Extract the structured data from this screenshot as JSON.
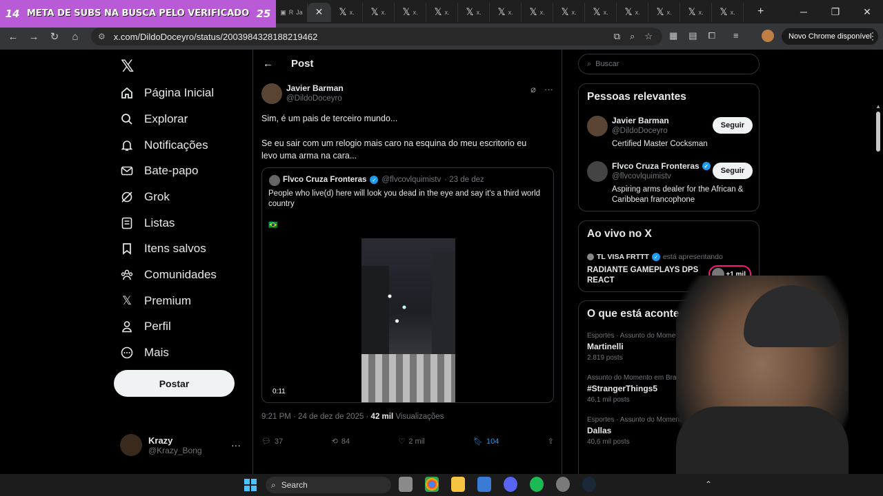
{
  "stream_overlay": {
    "left_count": "14",
    "goal_text": "META DE SUBS NA BUSCA PELO VERIFICADO",
    "right_count": "25"
  },
  "browser": {
    "tabs": [
      {
        "icon": "twitch-icon",
        "label": "R"
      },
      {
        "icon": "twitch-icon",
        "label": "Ja"
      },
      {
        "icon": "x-logo",
        "label": "x.",
        "active": true
      },
      {
        "icon": "x-logo",
        "label": "x."
      },
      {
        "icon": "x-logo",
        "label": "x."
      },
      {
        "icon": "x-logo",
        "label": "x."
      },
      {
        "icon": "x-logo",
        "label": "x."
      },
      {
        "icon": "x-logo",
        "label": "x."
      },
      {
        "icon": "x-logo",
        "label": "x."
      },
      {
        "icon": "x-logo",
        "label": "x."
      },
      {
        "icon": "x-logo",
        "label": "x."
      },
      {
        "icon": "x-logo",
        "label": "x."
      },
      {
        "icon": "x-logo",
        "label": "x."
      },
      {
        "icon": "x-logo",
        "label": "x."
      },
      {
        "icon": "x-logo",
        "label": "x."
      },
      {
        "icon": "x-logo",
        "label": "x."
      }
    ],
    "url": "x.com/DildoDoceyro/status/2003984328188219462",
    "update_button": "Novo Chrome disponível"
  },
  "nav": {
    "items": [
      {
        "icon": "home-icon",
        "label": "Página Inicial"
      },
      {
        "icon": "search-icon",
        "label": "Explorar"
      },
      {
        "icon": "bell-icon",
        "label": "Notificações"
      },
      {
        "icon": "mail-icon",
        "label": "Bate-papo"
      },
      {
        "icon": "grok-icon",
        "label": "Grok"
      },
      {
        "icon": "list-icon",
        "label": "Listas"
      },
      {
        "icon": "bookmark-icon",
        "label": "Itens salvos"
      },
      {
        "icon": "communities-icon",
        "label": "Comunidades"
      },
      {
        "icon": "x-logo",
        "label": "Premium"
      },
      {
        "icon": "person-icon",
        "label": "Perfil"
      },
      {
        "icon": "more-circle-icon",
        "label": "Mais"
      }
    ],
    "post_button": "Postar",
    "account": {
      "name": "Krazy",
      "handle": "@Krazy_Bong"
    }
  },
  "post": {
    "header_title": "Post",
    "author": {
      "name": "Javier Barman",
      "handle": "@DildoDoceyro"
    },
    "text_line1": "Sim, é um pais de terceiro mundo...",
    "text_line2": "Se eu sair com um relogio mais caro na esquina do meu escritorio eu levo uma arma na cara...",
    "quoted": {
      "name": "Flvco Cruza Fronteras",
      "handle": "@flvcovlquimistv",
      "date": "· 23 de dez",
      "text": "People who live(d) here will look you dead in the eye and say it's a third world country",
      "flag": "🇧🇷",
      "video_time": "0:11"
    },
    "meta": {
      "time": "9:21 PM · 24 de dez de 2025 · ",
      "views": "42 mil",
      "views_label": " Visualizações"
    },
    "stats": {
      "replies": "37",
      "reposts": "84",
      "likes": "2 mil",
      "bookmarks": "104"
    }
  },
  "sidebar": {
    "search_placeholder": "Buscar",
    "relevant": {
      "title": "Pessoas relevantes",
      "people": [
        {
          "name": "Javier Barman",
          "handle": "@DildoDoceyro",
          "bio": "Certified Master Cocksman",
          "button": "Seguir"
        },
        {
          "name": "Flvco Cruza Fronteras",
          "handle": "@flvcovlquimistv",
          "bio": "Aspiring arms dealer for the African & Caribbean francophone",
          "button": "Seguir"
        }
      ]
    },
    "live": {
      "title": "Ao vivo no X",
      "host": "TL VISA FRTTT",
      "status": "está apresentando",
      "stream_title": "RADIANTE GAMEPLAYS DPS REACT",
      "viewers": "+1 mil"
    },
    "trending": {
      "title": "O que está acontecendo",
      "items": [
        {
          "category": "Esportes · Assunto do Momento",
          "topic": "Martinelli",
          "count": "2.819 posts"
        },
        {
          "category": "Assunto do Momento em Brasil",
          "topic": "#StrangerThings5",
          "count": "46,1 mil posts"
        },
        {
          "category": "Esportes · Assunto do Momento",
          "topic": "Dallas",
          "count": "40,6 mil posts"
        }
      ]
    }
  },
  "taskbar": {
    "search_label": "Search"
  },
  "colors": {
    "accent": "#1d9bf0",
    "overlay": "#b95bd6",
    "live": "#f91880"
  }
}
